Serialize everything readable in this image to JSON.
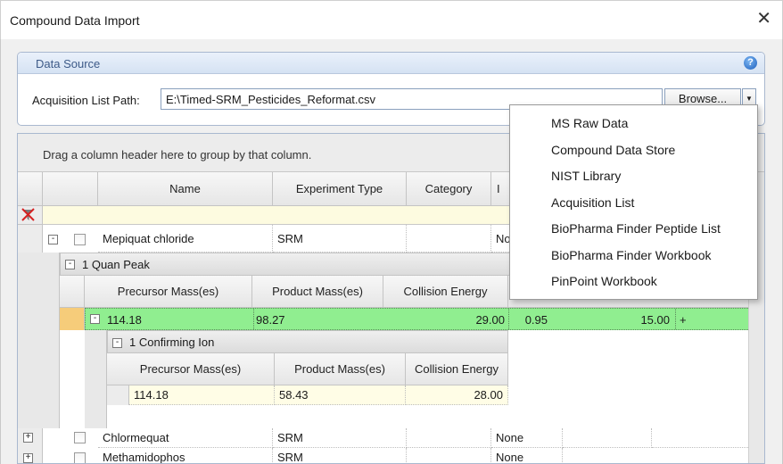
{
  "window": {
    "title": "Compound Data Import"
  },
  "data_source": {
    "title": "Data Source",
    "acq_label": "Acquisition List Path:",
    "acq_value": "E:\\Timed-SRM_Pesticides_Reformat.csv",
    "browse_label": "Browse..."
  },
  "grid": {
    "group_hint": "Drag a column header here to group by that column.",
    "columns": [
      "Name",
      "Experiment Type",
      "Category",
      "I"
    ],
    "rows": [
      {
        "name": "Mepiquat chloride",
        "type": "SRM",
        "category": "",
        "col4": "No",
        "expanded": "-"
      },
      {
        "name": "Chlormequat",
        "type": "SRM",
        "category": "",
        "col4": "None",
        "expanded": "+"
      },
      {
        "name": "Methamidophos",
        "type": "SRM",
        "category": "",
        "col4": "None",
        "expanded": "+"
      }
    ],
    "quan": {
      "band_title": "1 Quan Peak",
      "columns": [
        "Precursor Mass(es)",
        "Product Mass(es)",
        "Collision Energy"
      ],
      "row": {
        "precursor": "114.18",
        "product": "98.27",
        "ce": "29.00",
        "col4": "0.95",
        "col5": "15.00",
        "col6": "+"
      }
    },
    "confirm": {
      "band_title": "1 Confirming Ion",
      "columns": [
        "Precursor Mass(es)",
        "Product Mass(es)",
        "Collision Energy"
      ],
      "row": {
        "precursor": "114.18",
        "product": "58.43",
        "ce": "28.00"
      }
    }
  },
  "menu": {
    "items": [
      "MS Raw Data",
      "Compound Data Store",
      "NIST Library",
      "Acquisition List",
      "BioPharma Finder Peptide List",
      "BioPharma Finder Workbook",
      "PinPoint Workbook"
    ]
  },
  "colors": {
    "selected_row": "#90ee90",
    "filter_row": "#fdfbe0",
    "confirm_row": "#fffde6",
    "accent": "#3d5a88"
  }
}
